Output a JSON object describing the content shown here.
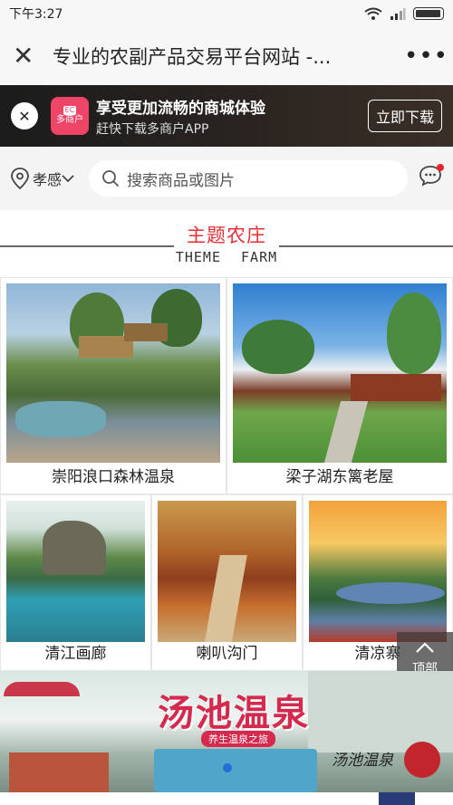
{
  "status_bar": {
    "time": "下午3:27"
  },
  "title_bar": {
    "close_glyph": "✕",
    "title": "专业的农副产品交易平台网站 -...",
    "more_glyph": "•••"
  },
  "app_banner": {
    "close_glyph": "✕",
    "logo_top": "EC",
    "logo_text": "多商户",
    "headline": "享受更加流畅的商城体验",
    "subline": "赶快下载多商户APP",
    "download_label": "立即下载"
  },
  "search": {
    "location": "孝感",
    "placeholder": "搜索商品或图片"
  },
  "section": {
    "title_cn": "主题农庄",
    "title_en": "THEME FARM"
  },
  "farms": [
    {
      "name": "崇阳浪口森林温泉"
    },
    {
      "name": "梁子湖东篱老屋"
    },
    {
      "name": "清江画廊"
    },
    {
      "name": "喇叭沟门"
    },
    {
      "name": "清凉寨"
    }
  ],
  "top_button": {
    "label": "顶部"
  },
  "spa_banner": {
    "title": "汤池温泉",
    "subtitle": "养生温泉之旅",
    "logo_text": "汤池温泉"
  },
  "colors": {
    "accent": "#e62e35",
    "banner_dark": "#1c1c1c",
    "indicator": "#1f6fd8"
  }
}
